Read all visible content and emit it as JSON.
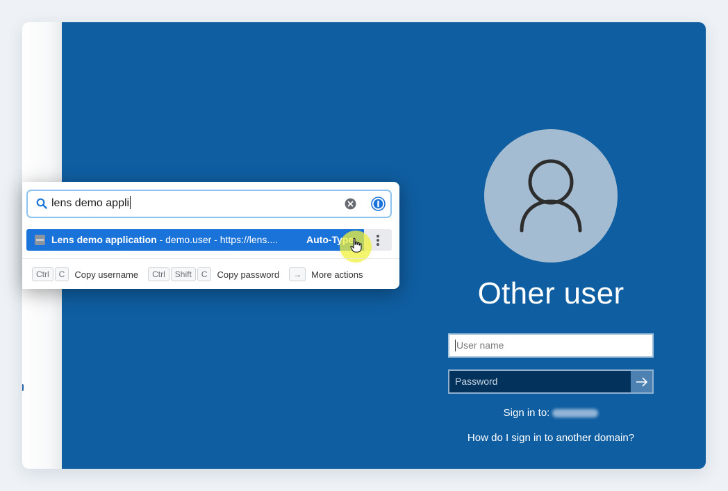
{
  "lock_screen": {
    "user_title": "Other user",
    "username_placeholder": "User name",
    "password_placeholder": "Password",
    "sign_in_to_label": "Sign in to:",
    "other_domain_link": "How do I sign in to another domain?",
    "background_color": "#0f5ea1"
  },
  "popup": {
    "search_query": "lens demo appli",
    "result": {
      "title": "Lens demo application",
      "details": " - demo.user - https://lens....",
      "action": "Auto-Type"
    },
    "shortcuts": [
      {
        "keys": [
          "Ctrl",
          "C"
        ],
        "label": "Copy username"
      },
      {
        "keys": [
          "Ctrl",
          "Shift",
          "C"
        ],
        "label": "Copy password"
      },
      {
        "keys": [
          "→"
        ],
        "label": "More actions"
      }
    ],
    "accent_color": "#1a73d9"
  }
}
